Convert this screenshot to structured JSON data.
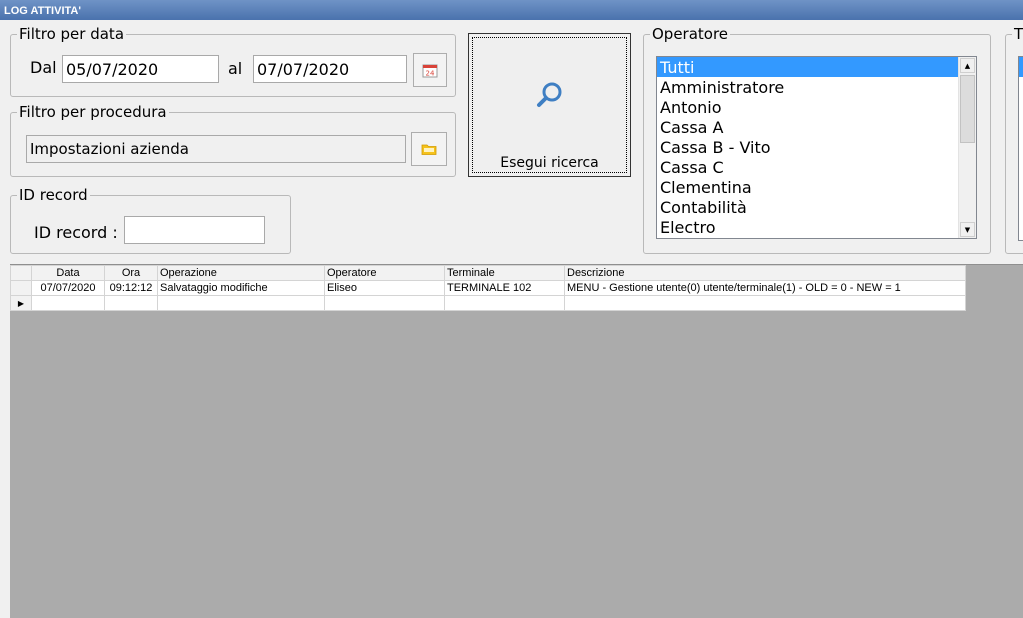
{
  "window": {
    "title": "LOG ATTIVITA'"
  },
  "filtro_data": {
    "legend": "Filtro per data",
    "dal_label": "Dal",
    "dal_value": "05/07/2020",
    "al_label": "al",
    "al_value": "07/07/2020",
    "calendar_icon_text": "24"
  },
  "filtro_procedura": {
    "legend": "Filtro per procedura",
    "value": "Impostazioni azienda"
  },
  "id_record": {
    "legend": "ID record",
    "label": "ID record :",
    "value": ""
  },
  "search_button": {
    "label": "Esegui ricerca"
  },
  "operatore": {
    "legend": "Operatore",
    "items": [
      "Tutti",
      "Amministratore",
      "Antonio",
      "Cassa A",
      "Cassa B - Vito",
      "Cassa C",
      "Clementina",
      "Contabilità",
      "Electro"
    ],
    "selected": "Tutti"
  },
  "terminale_group": {
    "legend": "T"
  },
  "grid": {
    "columns": [
      "Data",
      "Ora",
      "Operazione",
      "Operatore",
      "Terminale",
      "Descrizione"
    ],
    "rows": [
      {
        "data": "07/07/2020",
        "ora": "09:12:12",
        "operazione": "Salvataggio modifiche",
        "operatore": "Eliseo",
        "terminale": "TERMINALE 102",
        "descrizione": "MENU - Gestione utente(0) utente/terminale(1) - OLD = 0 - NEW = 1"
      }
    ]
  }
}
